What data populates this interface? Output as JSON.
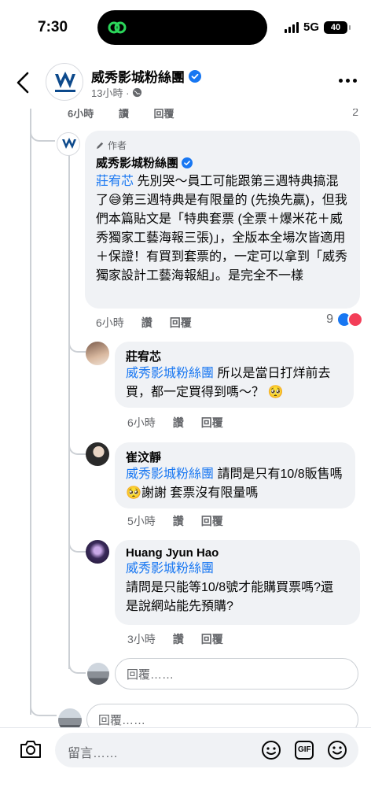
{
  "status_bar": {
    "time": "7:30",
    "network": "5G",
    "battery": "40"
  },
  "header": {
    "page_name": "威秀影城粉絲團",
    "meta_time": "13小時 ·"
  },
  "cutoff": {
    "time": "6小時",
    "like": "讀",
    "reply": "回覆",
    "count": "2"
  },
  "main_comment": {
    "author_badge": "作者",
    "name": "威秀影城粉絲團",
    "mention": "莊宥芯",
    "text": " 先別哭～員工可能跟第三週特典搞混了😅第三週特典是有限量的 (先換先贏)，但我們本篇貼文是「特典套票 (全票＋爆米花＋威秀獨家工藝海報三張)」，全版本全場次皆適用＋保證！有買到套票的，一定可以拿到「威秀獨家設計工藝海報組」。是完全不一樣",
    "time": "6小時",
    "like": "讚",
    "reply": "回覆",
    "reaction_count": "9"
  },
  "replies": [
    {
      "name": "莊宥芯",
      "mention": "威秀影城粉絲團",
      "text": " 所以是當日打烊前去買，都一定買得到嗎～？ 🥺",
      "time": "6小時",
      "like": "讚",
      "reply": "回覆"
    },
    {
      "name": "崔汶靜",
      "mention": "威秀影城粉絲團",
      "text": " 請問是只有10/8販售嗎🥺謝謝 套票沒有限量嗎",
      "time": "5小時",
      "like": "讚",
      "reply": "回覆"
    },
    {
      "name": "Huang Jyun Hao",
      "mention": "威秀影城粉絲團",
      "text": "請問是只能等10/8號才能購買票嗎?還是說網站能先預購?",
      "time": "3小時",
      "like": "讚",
      "reply": "回覆"
    }
  ],
  "inner_reply_placeholder": "回覆……",
  "outer_reply_placeholder": "回覆……",
  "composer": {
    "placeholder": "留言……",
    "gif_label": "GIF"
  },
  "colors": {
    "accent": "#1877f2",
    "bubble": "#f0f2f5",
    "secondary_text": "#65676b"
  }
}
